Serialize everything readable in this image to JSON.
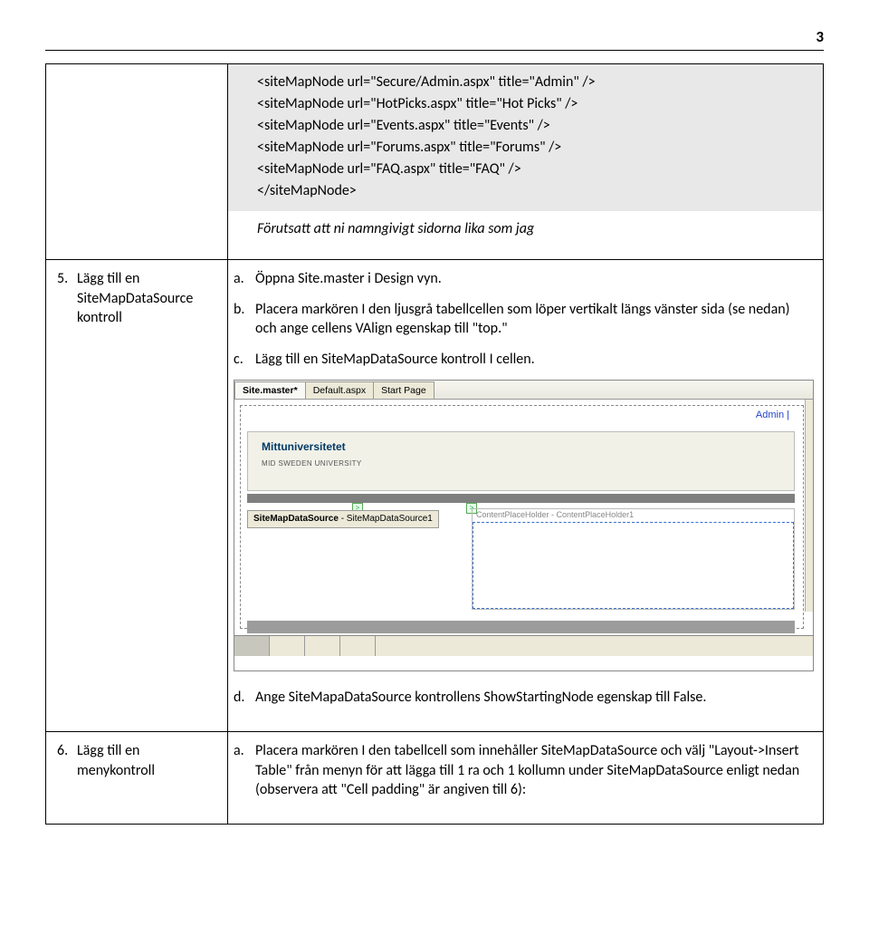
{
  "page_number": "3",
  "code": "<siteMapNode url=\"Secure/Admin.aspx\" title=\"Admin\" />\n<siteMapNode url=\"HotPicks.aspx\" title=\"Hot Picks\" />\n<siteMapNode url=\"Events.aspx\" title=\"Events\" />\n<siteMapNode url=\"Forums.aspx\" title=\"Forums\" />\n<siteMapNode url=\"FAQ.aspx\" title=\"FAQ\" />\n</siteMapNode>",
  "note_after_code": "Förutsatt att ni namngivigt sidorna lika som jag",
  "step5": {
    "num": "5.",
    "title": "Lägg till en SiteMapDataSource kontroll",
    "a_marker": "a.",
    "a_text": "Öppna Site.master i Design vyn.",
    "b_marker": "b.",
    "b_text": "Placera markören I den ljusgrå tabellcellen som löper vertikalt längs vänster sida (se nedan) och ange cellens VAlign egenskap till \"top.\"",
    "c_marker": "c.",
    "c_text": "Lägg till en SiteMapDataSource kontroll I cellen."
  },
  "screenshot": {
    "tab1": "Site.master*",
    "tab2": "Default.aspx",
    "tab3": "Start Page",
    "admin_label": "Admin |",
    "logo_main": "Mittuniversitetet",
    "logo_sub": "MID SWEDEN UNIVERSITY",
    "sitemap_bold": "SiteMapDataSource",
    "sitemap_rest": " - SiteMapDataSource1",
    "cph_label": "ContentPlaceHolder - ContentPlaceHolder1"
  },
  "step5d": {
    "marker": "d.",
    "text": "Ange SiteMapaDataSource kontrollens ShowStartingNode egenskap till False."
  },
  "step6": {
    "num": "6.",
    "title": "Lägg till en menykontroll",
    "a_marker": "a.",
    "a_text": "Placera markören I den tabellcell som innehåller SiteMapDataSource och välj \"Layout->Insert Table\" från menyn för att lägga till 1 ra och 1 kollumn under SiteMapDataSource enligt nedan (observera att \"Cell padding\" är angiven till 6):"
  }
}
